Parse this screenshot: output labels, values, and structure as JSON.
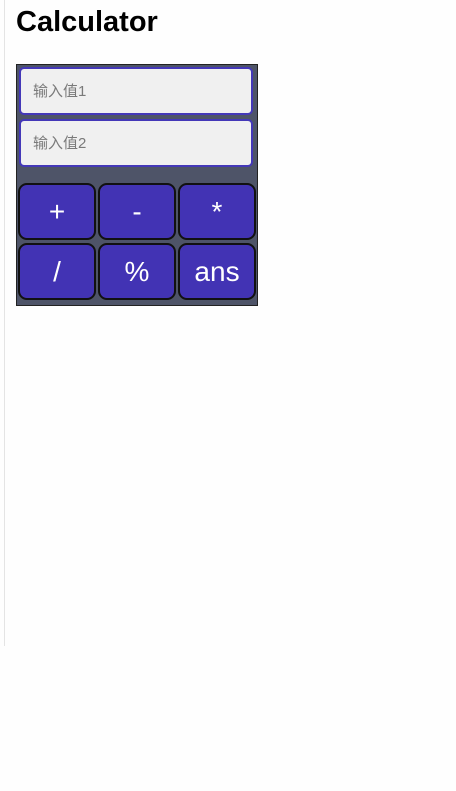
{
  "page": {
    "title": "Calculator"
  },
  "inputs": {
    "value1": {
      "placeholder": "输入值1",
      "value": ""
    },
    "value2": {
      "placeholder": "输入值2",
      "value": ""
    }
  },
  "buttons": {
    "add": "+",
    "subtract": "-",
    "multiply": "*",
    "divide": "/",
    "modulo": "%",
    "ans": "ans"
  },
  "colors": {
    "page_background": "#fefefe",
    "panel_background": "#4e5468",
    "button_background": "#4233b4",
    "button_text": "#ffffff",
    "input_border": "#4438b8",
    "input_background": "#f0f0f0"
  }
}
